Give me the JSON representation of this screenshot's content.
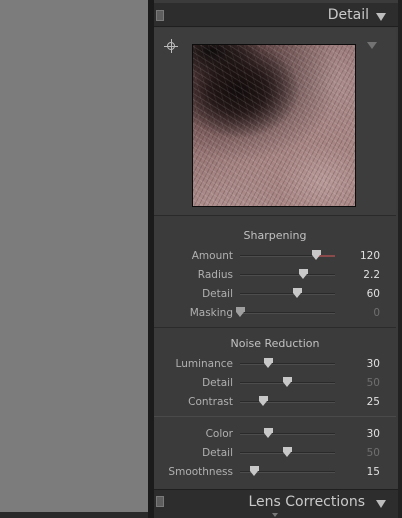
{
  "detail_panel": {
    "title": "Detail",
    "preview_alt": "detail zoom preview"
  },
  "sharpening": {
    "title": "Sharpening",
    "amount": {
      "label": "Amount",
      "value": "120",
      "fraction": 0.8
    },
    "radius": {
      "label": "Radius",
      "value": "2.2",
      "fraction": 0.667
    },
    "detail": {
      "label": "Detail",
      "value": "60",
      "fraction": 0.6
    },
    "masking": {
      "label": "Masking",
      "value": "0",
      "fraction": 0.0
    }
  },
  "noise_reduction": {
    "title": "Noise Reduction",
    "luminance": {
      "label": "Luminance",
      "value": "30",
      "fraction": 0.3
    },
    "lum_detail": {
      "label": "Detail",
      "value": "50",
      "fraction": 0.5
    },
    "contrast": {
      "label": "Contrast",
      "value": "25",
      "fraction": 0.25
    },
    "color": {
      "label": "Color",
      "value": "30",
      "fraction": 0.3
    },
    "color_detail": {
      "label": "Detail",
      "value": "50",
      "fraction": 0.5
    },
    "smoothness": {
      "label": "Smoothness",
      "value": "15",
      "fraction": 0.15
    }
  },
  "next_panel": {
    "title": "Lens Corrections"
  },
  "colors": {
    "panel_bg": "#3b3b3b",
    "header_bg": "#2d2d2d",
    "left_area": "#7c7c7c",
    "amount_highlight": "#8a4a4a"
  }
}
